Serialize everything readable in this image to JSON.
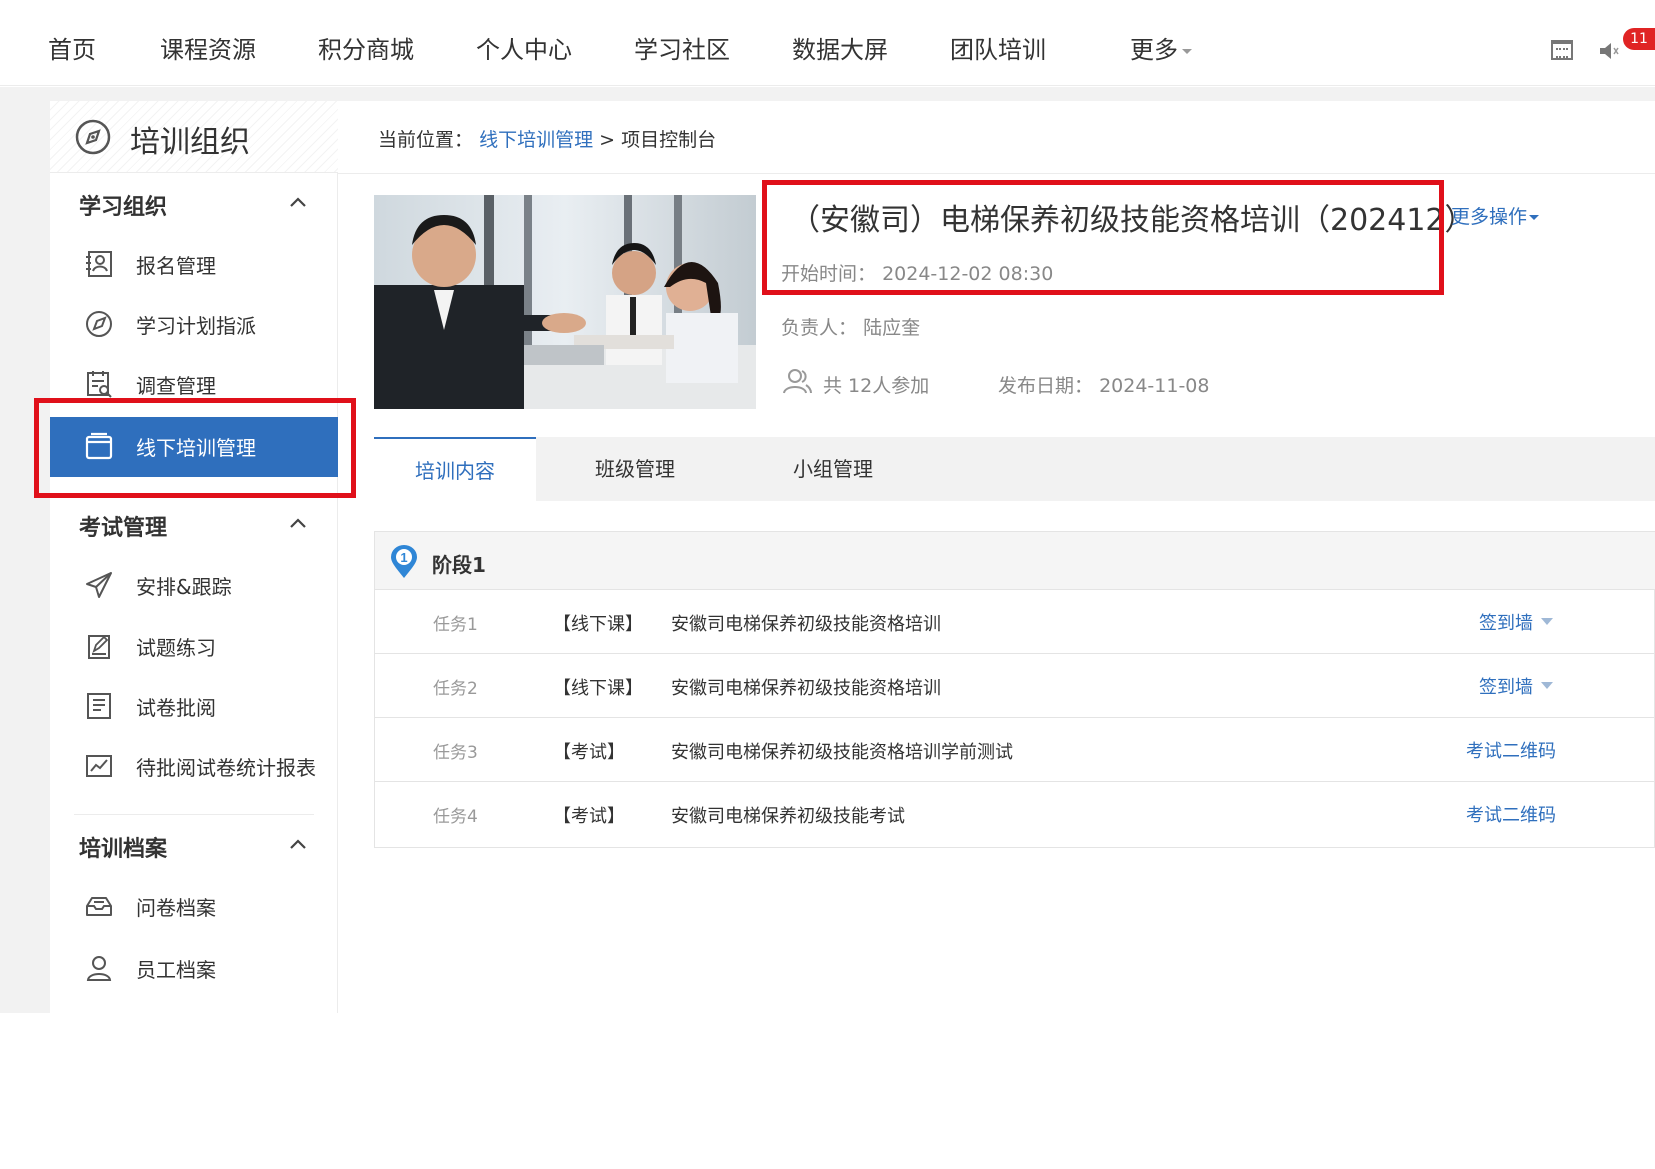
{
  "topnav": {
    "items": [
      "首页",
      "课程资源",
      "积分商城",
      "个人中心",
      "学习社区",
      "数据大屏",
      "团队培训",
      "更多"
    ],
    "badge_count": "11",
    "icons": [
      "calendar-icon",
      "speaker-icon"
    ]
  },
  "sidebar": {
    "title": "培训组织",
    "sections": [
      {
        "title": "学习组织",
        "items": [
          {
            "label": "报名管理",
            "icon": "user-card-icon"
          },
          {
            "label": "学习计划指派",
            "icon": "compass-send-icon"
          },
          {
            "label": "调查管理",
            "icon": "survey-icon"
          },
          {
            "label": "线下培训管理",
            "icon": "window-icon",
            "active": true
          }
        ]
      },
      {
        "title": "考试管理",
        "items": [
          {
            "label": "安排&跟踪",
            "icon": "paper-plane-icon"
          },
          {
            "label": "试题练习",
            "icon": "edit-icon"
          },
          {
            "label": "试卷批阅",
            "icon": "list-doc-icon"
          },
          {
            "label": "待批阅试卷统计报表",
            "icon": "chart-icon"
          }
        ]
      },
      {
        "title": "培训档案",
        "items": [
          {
            "label": "问卷档案",
            "icon": "tray-icon"
          },
          {
            "label": "员工档案",
            "icon": "person-icon"
          }
        ]
      }
    ]
  },
  "breadcrumb": {
    "prefix": "当前位置：",
    "link": "线下培训管理",
    "separator": ">",
    "current": "项目控制台"
  },
  "course": {
    "title": "（安徽司）电梯保养初级技能资格培训（202412）",
    "more_ops": "更多操作",
    "start_label": "开始时间：",
    "start_value": "2024-12-02 08:30",
    "owner_label": "负责人：",
    "owner_value": "陆应奎",
    "participants": "共 12人参加",
    "publish_label": "发布日期：",
    "publish_value": "2024-11-08"
  },
  "tabs": [
    "培训内容",
    "班级管理",
    "小组管理"
  ],
  "stage": {
    "label": "阶段1",
    "tasks": [
      {
        "no": "任务1",
        "type": "【线下课】",
        "name": "安徽司电梯保养初级技能资格培训",
        "action": "签到墙",
        "dropdown": true
      },
      {
        "no": "任务2",
        "type": "【线下课】",
        "name": "安徽司电梯保养初级技能资格培训",
        "action": "签到墙",
        "dropdown": true
      },
      {
        "no": "任务3",
        "type": "【考试】",
        "name": "安徽司电梯保养初级技能资格培训学前测试",
        "action": "考试二维码",
        "dropdown": false
      },
      {
        "no": "任务4",
        "type": "【考试】",
        "name": "安徽司电梯保养初级技能考试",
        "action": "考试二维码",
        "dropdown": false
      }
    ]
  },
  "colors": {
    "accent": "#2f6fbd",
    "highlight": "#e0101a",
    "badge": "#e02424"
  }
}
